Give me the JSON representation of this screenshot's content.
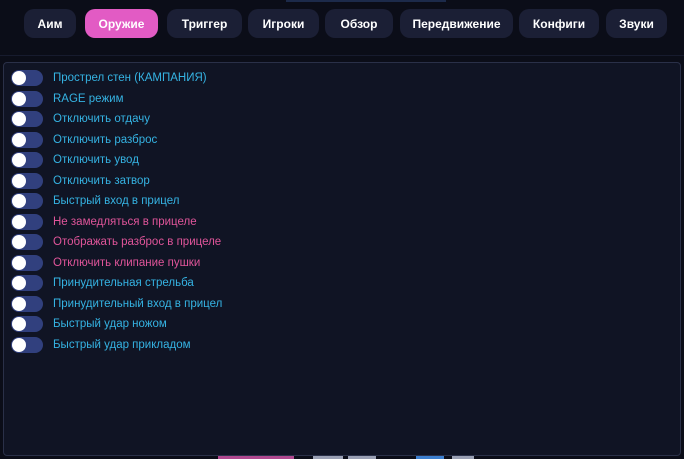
{
  "tabs": [
    {
      "label": "Аим",
      "active": false
    },
    {
      "label": "Оружие",
      "active": true
    },
    {
      "label": "Триггер",
      "active": false
    },
    {
      "label": "Игроки",
      "active": false
    },
    {
      "label": "Обзор",
      "active": false
    },
    {
      "label": "Передвижение",
      "active": false
    },
    {
      "label": "Конфиги",
      "active": false
    },
    {
      "label": "Звуки",
      "active": false
    }
  ],
  "options": [
    {
      "label": "Прострел стен (КАМПАНИЯ)",
      "color": "#35b3e3",
      "enabled": false
    },
    {
      "label": "RAGE режим",
      "color": "#35b3e3",
      "enabled": false
    },
    {
      "label": "Отключить отдачу",
      "color": "#35b3e3",
      "enabled": false
    },
    {
      "label": "Отключить разброс",
      "color": "#35b3e3",
      "enabled": false
    },
    {
      "label": "Отключить увод",
      "color": "#35b3e3",
      "enabled": false
    },
    {
      "label": "Отключить затвор",
      "color": "#35b3e3",
      "enabled": false
    },
    {
      "label": "Быстрый вход в прицел",
      "color": "#35b3e3",
      "enabled": false
    },
    {
      "label": "Не замедляться в прицеле",
      "color": "#e0559a",
      "enabled": false
    },
    {
      "label": "Отображать разброс в прицеле",
      "color": "#e0559a",
      "enabled": false
    },
    {
      "label": "Отключить клипание пушки",
      "color": "#e0559a",
      "enabled": false
    },
    {
      "label": "Принудительная стрельба",
      "color": "#35b3e3",
      "enabled": false
    },
    {
      "label": "Принудительный вход в прицел",
      "color": "#35b3e3",
      "enabled": false
    },
    {
      "label": "Быстрый удар ножом",
      "color": "#35b3e3",
      "enabled": false
    },
    {
      "label": "Быстрый удар прикладом",
      "color": "#35b3e3",
      "enabled": false
    }
  ],
  "colors": {
    "accent": "#e25bc4",
    "toggle_off": "#31407e",
    "label_blue": "#35b3e3",
    "label_pink": "#e0559a",
    "panel_bg": "#101424",
    "tab_bg": "#1b1f35"
  }
}
